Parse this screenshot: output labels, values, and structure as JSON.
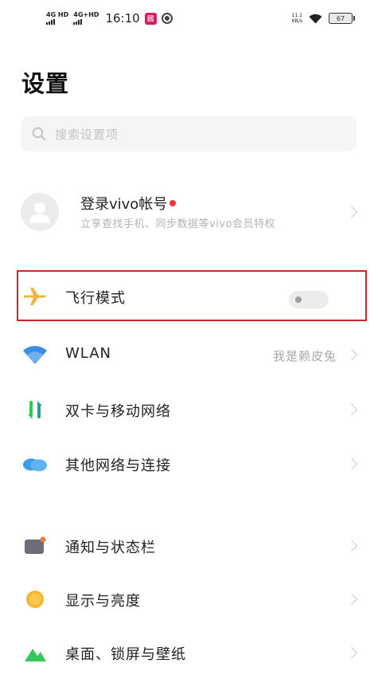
{
  "status_bar": {
    "sim1_label": "4G HD",
    "sim2_label": "4G+HD",
    "time": "16:10",
    "app_badge": "回",
    "net_speed_value": "11.1",
    "net_speed_unit": "KB/s",
    "battery": "67"
  },
  "page_title": "设置",
  "search": {
    "placeholder": "搜索设置项"
  },
  "account": {
    "title": "登录vivo帐号",
    "subtitle": "立享查找手机、同步数据等vivo会员特权",
    "has_notification_dot": true
  },
  "settings": {
    "airplane": {
      "label": "飞行模式",
      "icon": "airplane-icon",
      "enabled": false
    },
    "wlan": {
      "label": "WLAN",
      "value": "我是赖皮兔",
      "icon": "wifi-icon"
    },
    "dual_sim": {
      "label": "双卡与移动网络",
      "icon": "dual-sim-icon"
    },
    "other_network": {
      "label": "其他网络与连接",
      "icon": "cloud-icon"
    },
    "notification": {
      "label": "通知与状态栏",
      "icon": "notification-icon"
    },
    "display": {
      "label": "显示与亮度",
      "icon": "brightness-icon"
    },
    "desktop": {
      "label": "桌面、锁屏与壁纸",
      "icon": "wallpaper-icon"
    }
  },
  "colors": {
    "highlight_border": "#c62828",
    "airplane": "#f2b33d",
    "wifi": "#3a8ee6",
    "dual_sim_green": "#34c759",
    "cloud": "#3d9be9",
    "brightness": "#f7b733"
  }
}
